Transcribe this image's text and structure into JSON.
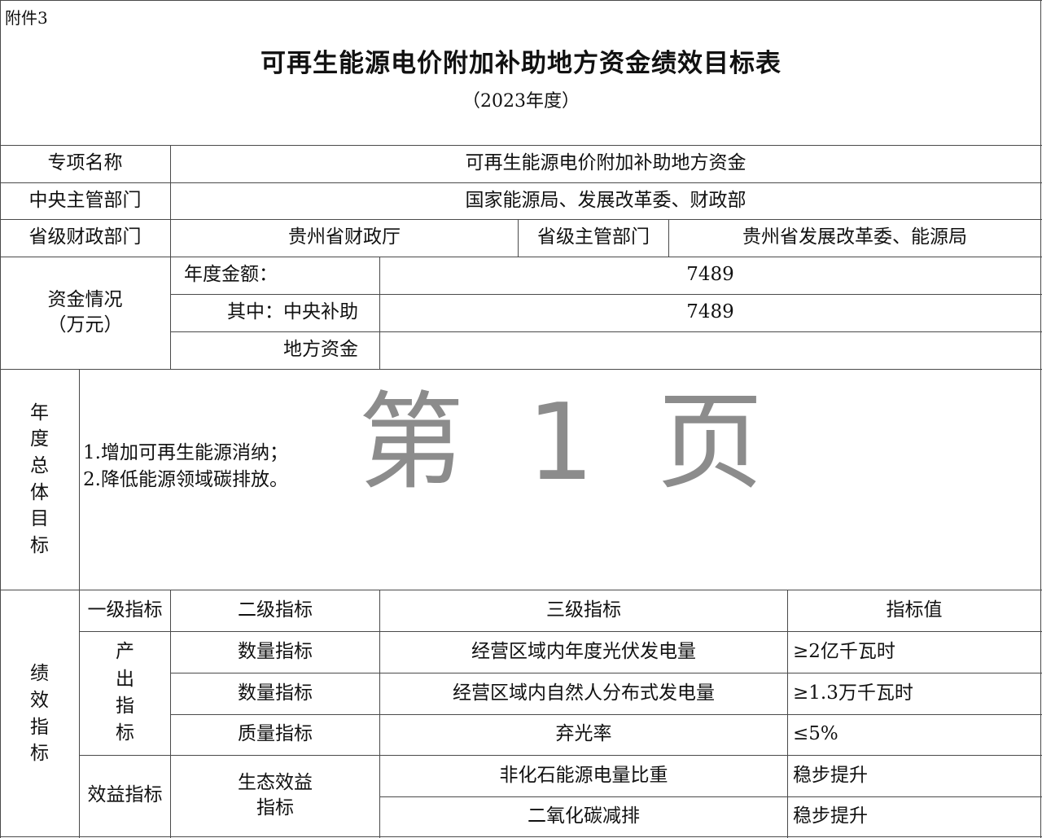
{
  "header": {
    "annex": "附件3",
    "title": "可再生能源电价附加补助地方资金绩效目标表",
    "year": "（2023年度）"
  },
  "watermark": "第 1 页",
  "info": {
    "project_name_label": "专项名称",
    "project_name": "可再生能源电价附加补助地方资金",
    "central_dept_label": "中央主管部门",
    "central_dept": "国家能源局、发展改革委、财政部",
    "prov_finance_label": "省级财政部门",
    "prov_finance": "贵州省财政厅",
    "prov_dept_label": "省级主管部门",
    "prov_dept": "贵州省发展改革委、能源局"
  },
  "funds": {
    "label_line1": "资金情况",
    "label_line2": "（万元）",
    "annual_label": "年度金额：",
    "annual_value": "7489",
    "central_label": "其中：中央补助",
    "central_value": "7489",
    "local_label": "地方资金",
    "local_value": ""
  },
  "goals": {
    "label_chars": [
      "年",
      "度",
      "总",
      "体",
      "目",
      "标"
    ],
    "items": [
      "1.增加可再生能源消纳；",
      "2.降低能源领域碳排放。"
    ]
  },
  "performance": {
    "label_chars": [
      "绩",
      "效",
      "指",
      "标"
    ],
    "headers": [
      "一级指标",
      "二级指标",
      "三级指标",
      "指标值"
    ],
    "output_label_chars": [
      "产",
      "出",
      "指",
      "标"
    ],
    "benefit_label": "效益指标",
    "eco_label_line1": "生态效益",
    "eco_label_line2": "指标",
    "rows": [
      {
        "level2": "数量指标",
        "level3": "经营区域内年度光伏发电量",
        "value": "≥2亿千瓦时"
      },
      {
        "level2": "数量指标",
        "level3": "经营区域内自然人分布式发电量",
        "value": "≥1.3万千瓦时"
      },
      {
        "level2": "质量指标",
        "level3": "弃光率",
        "value": "≤5%"
      },
      {
        "level3": "非化石能源电量比重",
        "value": "稳步提升"
      },
      {
        "level3": "二氧化碳减排",
        "value": "稳步提升"
      }
    ]
  }
}
